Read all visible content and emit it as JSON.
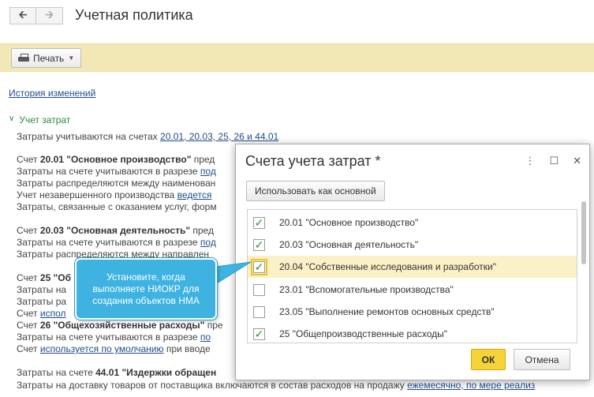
{
  "header": {
    "title": "Учетная политика",
    "back_icon": "arrow-left",
    "forward_icon": "arrow-right"
  },
  "toolbar": {
    "print_label": "Печать"
  },
  "content": {
    "history_link": "История изменений",
    "section_title": "Учет затрат",
    "accounts_line_prefix": "Затраты учитываются на счетах ",
    "accounts_line_link": "20.01, 20.03, 25, 26 и 44.01",
    "block_2001": {
      "prefix": "Счет ",
      "head": "20.01 \"Основное производство\"",
      "tail": " пред",
      "l1_text": "Затраты на счете учитываются в разрезе ",
      "l1_link": "под",
      "l2": "Затраты распределяются между наименован",
      "l3_text": "Учет незавершенного производства ",
      "l3_link": "ведется",
      "l4": "Затраты, связанные с оказанием услуг, форм"
    },
    "block_2003": {
      "prefix": "Счет ",
      "head": "20.03 \"Основная деятельность\"",
      "tail": " пред",
      "l1_text": "Затраты на счете учитываются в разрезе ",
      "l1_link": "под",
      "l2": "Затраты распределяются между направлен"
    },
    "block_25": {
      "prefix": "Счет ",
      "head": "25 \"Об",
      "l1": "Затраты на",
      "l2": "Затраты ра",
      "l3": "Счет ",
      "l3_link": "испол"
    },
    "block_26": {
      "prefix": "Счет ",
      "head": "26 \"Общехозяйственные расходы\"",
      "tail": " пре",
      "l1_text": "Затраты на счете учитываются в разрезе ",
      "l1_link": "по",
      "l2_prefix": "Счет ",
      "l2_link": "используется по умолчанию",
      "l2_tail": " при вводе"
    },
    "block_4401": {
      "prefix": "Затраты на счете ",
      "head": "44.01 \"Издержки обращен",
      "l1_text": "Затраты на доставку товаров от поставщика включаются в состав расходов на продажу ",
      "l1_link": "ежемесячно, по мере реализ"
    }
  },
  "dialog": {
    "title": "Счета учета затрат *",
    "more_icon": "more-vertical",
    "maximize_icon": "square",
    "close_icon": "close",
    "use_main_button": "Использовать как основной",
    "items": [
      {
        "label": "20.01 \"Основное производство\"",
        "checked": true,
        "selected": false
      },
      {
        "label": "20.03 \"Основная деятельность\"",
        "checked": true,
        "selected": false
      },
      {
        "label": "20.04 \"Собственные исследования и разработки\"",
        "checked": true,
        "selected": true
      },
      {
        "label": "23.01 \"Вспомогательные производства\"",
        "checked": false,
        "selected": false
      },
      {
        "label": "23.05 \"Выполнение ремонтов основных средств\"",
        "checked": false,
        "selected": false
      },
      {
        "label": "25 \"Общепроизводственные расходы\"",
        "checked": true,
        "selected": false
      }
    ],
    "ok_label": "ОК",
    "cancel_label": "Отмена"
  },
  "callout": {
    "text": "Установите, когда выполняете НИОКР для создания объектов НМА"
  },
  "colors": {
    "accent_yellow": "#f6d33a",
    "callout_blue": "#3eb3e2",
    "section_green": "#2a8a3a",
    "link_blue": "#1f4e8c"
  }
}
